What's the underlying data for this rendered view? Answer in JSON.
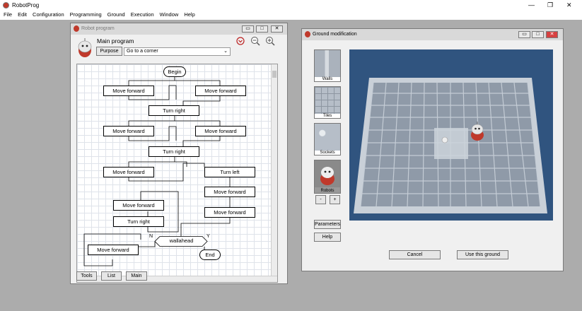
{
  "app": {
    "title": "RobotProg",
    "window_controls": {
      "minimize": "—",
      "restore": "❐",
      "close": "✕"
    }
  },
  "menu": [
    "File",
    "Edit",
    "Configuration",
    "Programming",
    "Ground",
    "Execution",
    "Window",
    "Help"
  ],
  "program_window": {
    "title": "Robot program",
    "program_name": "Main program",
    "purpose_button": "Purpose",
    "purpose_value": "Go to a corner",
    "nodes": {
      "begin": "Begin",
      "move_forward": "Move forward",
      "turn_right": "Turn right",
      "turn_left": "Turn left",
      "condition": "wallahead",
      "end": "End",
      "yes": "Y",
      "no": "N"
    },
    "bottom_buttons": {
      "tools": "Tools",
      "list": "List",
      "main": "Main"
    }
  },
  "ground_window": {
    "title": "Ground modification",
    "tools": [
      "Walls",
      "Tiles",
      "Sockets",
      "Robots"
    ],
    "minus": "-",
    "plus": "+",
    "parameters_button": "Parameters",
    "help_button": "Help",
    "cancel_button": "Cancel",
    "use_button": "Use this ground"
  },
  "colors": {
    "workspace": "#acacac",
    "scene_bg": "#30547f",
    "robot_red": "#c0392b"
  }
}
